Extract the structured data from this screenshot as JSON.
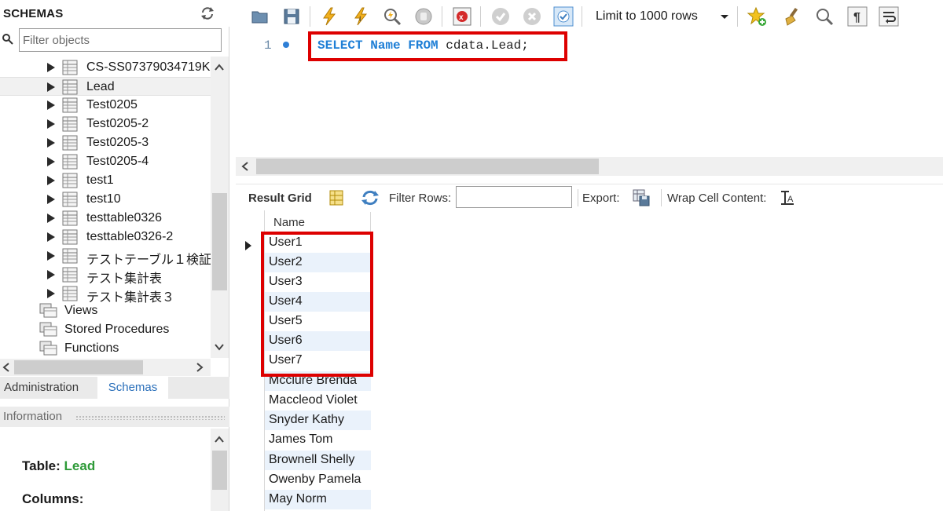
{
  "left_panel": {
    "title": "SCHEMAS",
    "filter_placeholder": "Filter objects",
    "tables": [
      {
        "label": "CS-SS07379034719K"
      },
      {
        "label": "Lead"
      },
      {
        "label": "Test0205"
      },
      {
        "label": "Test0205-2"
      },
      {
        "label": "Test0205-3"
      },
      {
        "label": "Test0205-4"
      },
      {
        "label": "test1"
      },
      {
        "label": "test10"
      },
      {
        "label": "testtable0326"
      },
      {
        "label": "testtable0326-2"
      },
      {
        "label": "テストテーブル１検証"
      },
      {
        "label": "テスト集計表"
      },
      {
        "label": "テスト集計表３"
      }
    ],
    "objects": [
      {
        "label": "Views"
      },
      {
        "label": "Stored Procedures"
      },
      {
        "label": "Functions"
      }
    ],
    "tabs": {
      "administration": "Administration",
      "schemas": "Schemas"
    },
    "information": {
      "title": "Information",
      "table_label": "Table:",
      "table_value": "Lead",
      "columns_label": "Columns:"
    }
  },
  "toolbar": {
    "limit_label": "Limit to 1000 rows"
  },
  "editor": {
    "line_number": "1",
    "sql": {
      "kw_select": "SELECT",
      "col": "Name",
      "kw_from": "FROM",
      "table": "cdata.Lead;"
    }
  },
  "result_toolbar": {
    "result_grid": "Result Grid",
    "filter_rows": "Filter Rows:",
    "export": "Export:",
    "wrap_cell": "Wrap Cell Content:"
  },
  "grid": {
    "column": "Name",
    "rows": [
      "User1",
      "User2",
      "User3",
      "User4",
      "User5",
      "User6",
      "User7",
      "Mcclure Brenda",
      "Maccleod Violet",
      "Snyder Kathy",
      "James Tom",
      "Brownell Shelly",
      "Owenby Pamela",
      "May Norm"
    ]
  },
  "colors": {
    "highlight_box": "#dd0000",
    "keyword": "#1f7fd6",
    "table_name": "#2e9a38",
    "alt_row": "#eaf2fb"
  }
}
